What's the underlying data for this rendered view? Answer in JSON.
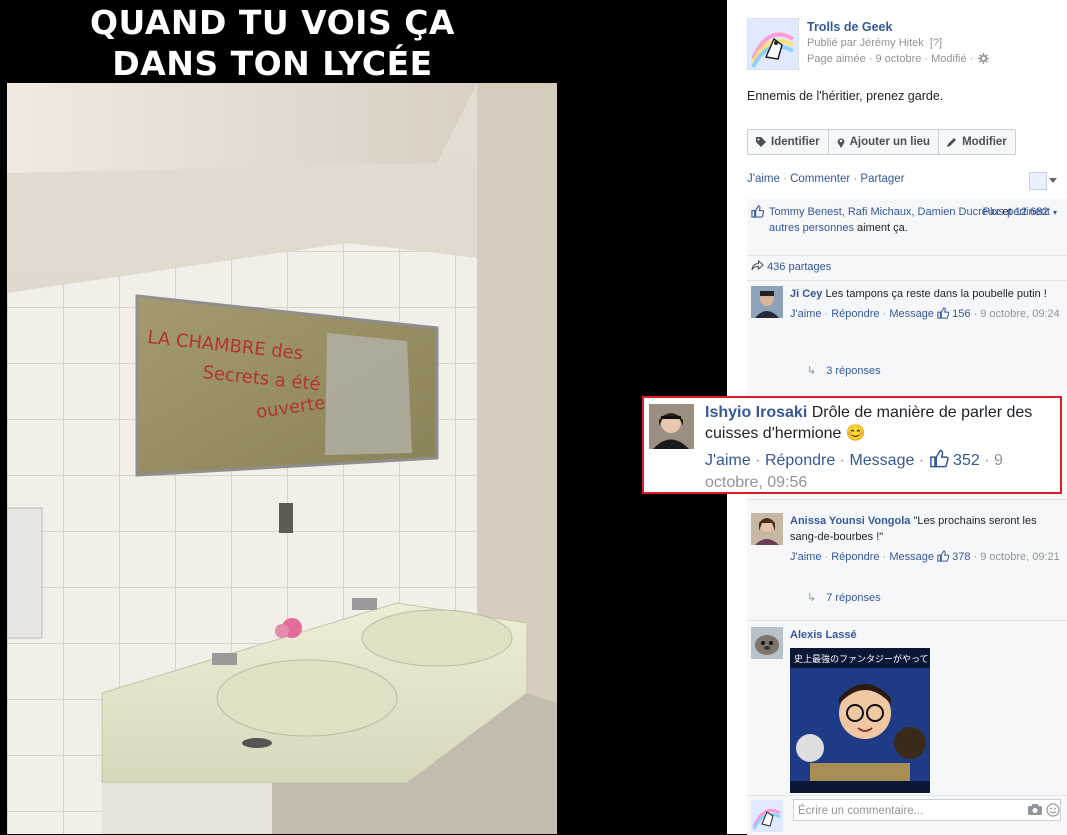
{
  "meme": {
    "caption_line1": "QUAND TU VOIS ÇA",
    "caption_line2": "DANS TON LYCÉE",
    "mirror_text_line1": "LA CHAMBRE des",
    "mirror_text_line2": "Secrets a été",
    "mirror_text_line3": "ouverte"
  },
  "post": {
    "page_name": "Trolls de Geek",
    "published_by": "Publié par Jérémy Hitek",
    "published_by_marker": "[?]",
    "meta": "Page aimée · 9 octobre · Modifié ·",
    "text": "Ennemis de l'héritier, prenez garde.",
    "tag_buttons": [
      "Identifier",
      "Ajouter un lieu",
      "Modifier"
    ],
    "actions": [
      "J'aime",
      "Commenter",
      "Partager"
    ]
  },
  "likes": {
    "names_line": "Tommy Benest, Rafi Michaux, Damien Ducreux",
    "connector": " et ",
    "others": "12 682 autres personnes",
    "suffix": " aiment ça.",
    "sort": "Plus pertinent"
  },
  "shares": "436 partages",
  "comments": [
    {
      "author": "Ji Cey",
      "text": "Les tampons ça reste dans la poubelle putin !",
      "like": "J'aime",
      "reply": "Répondre",
      "message": "Message",
      "count": "156",
      "date": "9 octobre, 09:24",
      "replies": "3 réponses"
    },
    {
      "author": "Ishyio Irosaki",
      "text": "Drôle de manière de parler des cuisses d'hermione 😊",
      "like": "J'aime",
      "reply": "Répondre",
      "message": "Message",
      "count": "352",
      "date": "9 octobre, 09:56"
    },
    {
      "author": "Anissa Younsi Vongola",
      "text": "\"Les prochains seront les sang-de-bourbes !\"",
      "like": "J'aime",
      "reply": "Répondre",
      "message": "Message",
      "count": "378",
      "date": "9 octobre, 09:21",
      "replies": "7 réponses"
    },
    {
      "author": "Alexis Lassé",
      "poster_text": "史上最強のファンタジーがやってくる"
    }
  ],
  "composer": {
    "placeholder": "Écrire un commentaire..."
  },
  "colors": {
    "link": "#365899",
    "highlight_border": "#e11b22",
    "muted": "#90949c"
  }
}
